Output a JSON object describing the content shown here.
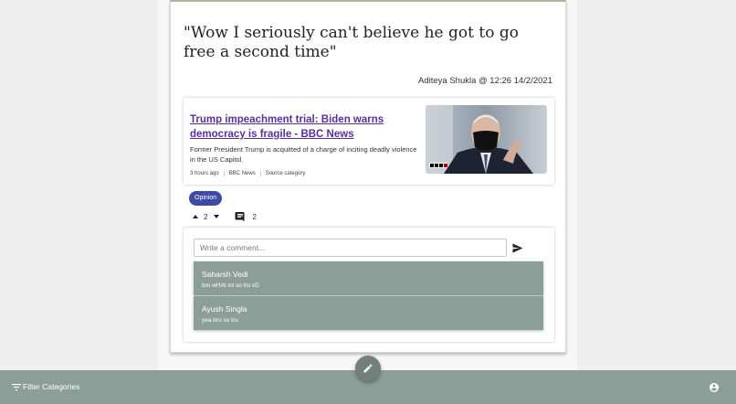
{
  "post": {
    "title": "\"Wow I seriously can't believe he got to go free a second time\"",
    "meta": "Aditeya Shukla @ 12:26 14/2/2021",
    "news": {
      "title": "Trump impeachment trial: Biden warns democracy is fragile - BBC News",
      "description": "Former President Trump is acquitted of a charge of inciting deadly violence in the US Capitol.",
      "time": "3 hours ago",
      "source": "BBC News",
      "category": "Source category",
      "thumbnail_badge": "BBC NEWS"
    },
    "tag": "Opinion",
    "votes": "2",
    "comment_count": "2"
  },
  "comments": {
    "placeholder": "Write a comment...",
    "items": [
      {
        "author": "Saharsh Vedi",
        "text": "bro wHAt lol so tru xD"
      },
      {
        "author": "Ayush Singla",
        "text": "yea bro so tru"
      }
    ]
  },
  "bottom_bar": {
    "filter_label": "Filter Categories"
  },
  "icons": {
    "upvote": "arrow-up-icon",
    "downvote": "arrow-down-icon",
    "comment": "comment-icon",
    "send": "send-icon",
    "edit": "pencil-icon",
    "filter": "filter-icon",
    "account": "account-circle-icon"
  },
  "colors": {
    "accent": "#3f4aa3",
    "bar": "#8b9f98",
    "link": "#5b2f9a"
  }
}
